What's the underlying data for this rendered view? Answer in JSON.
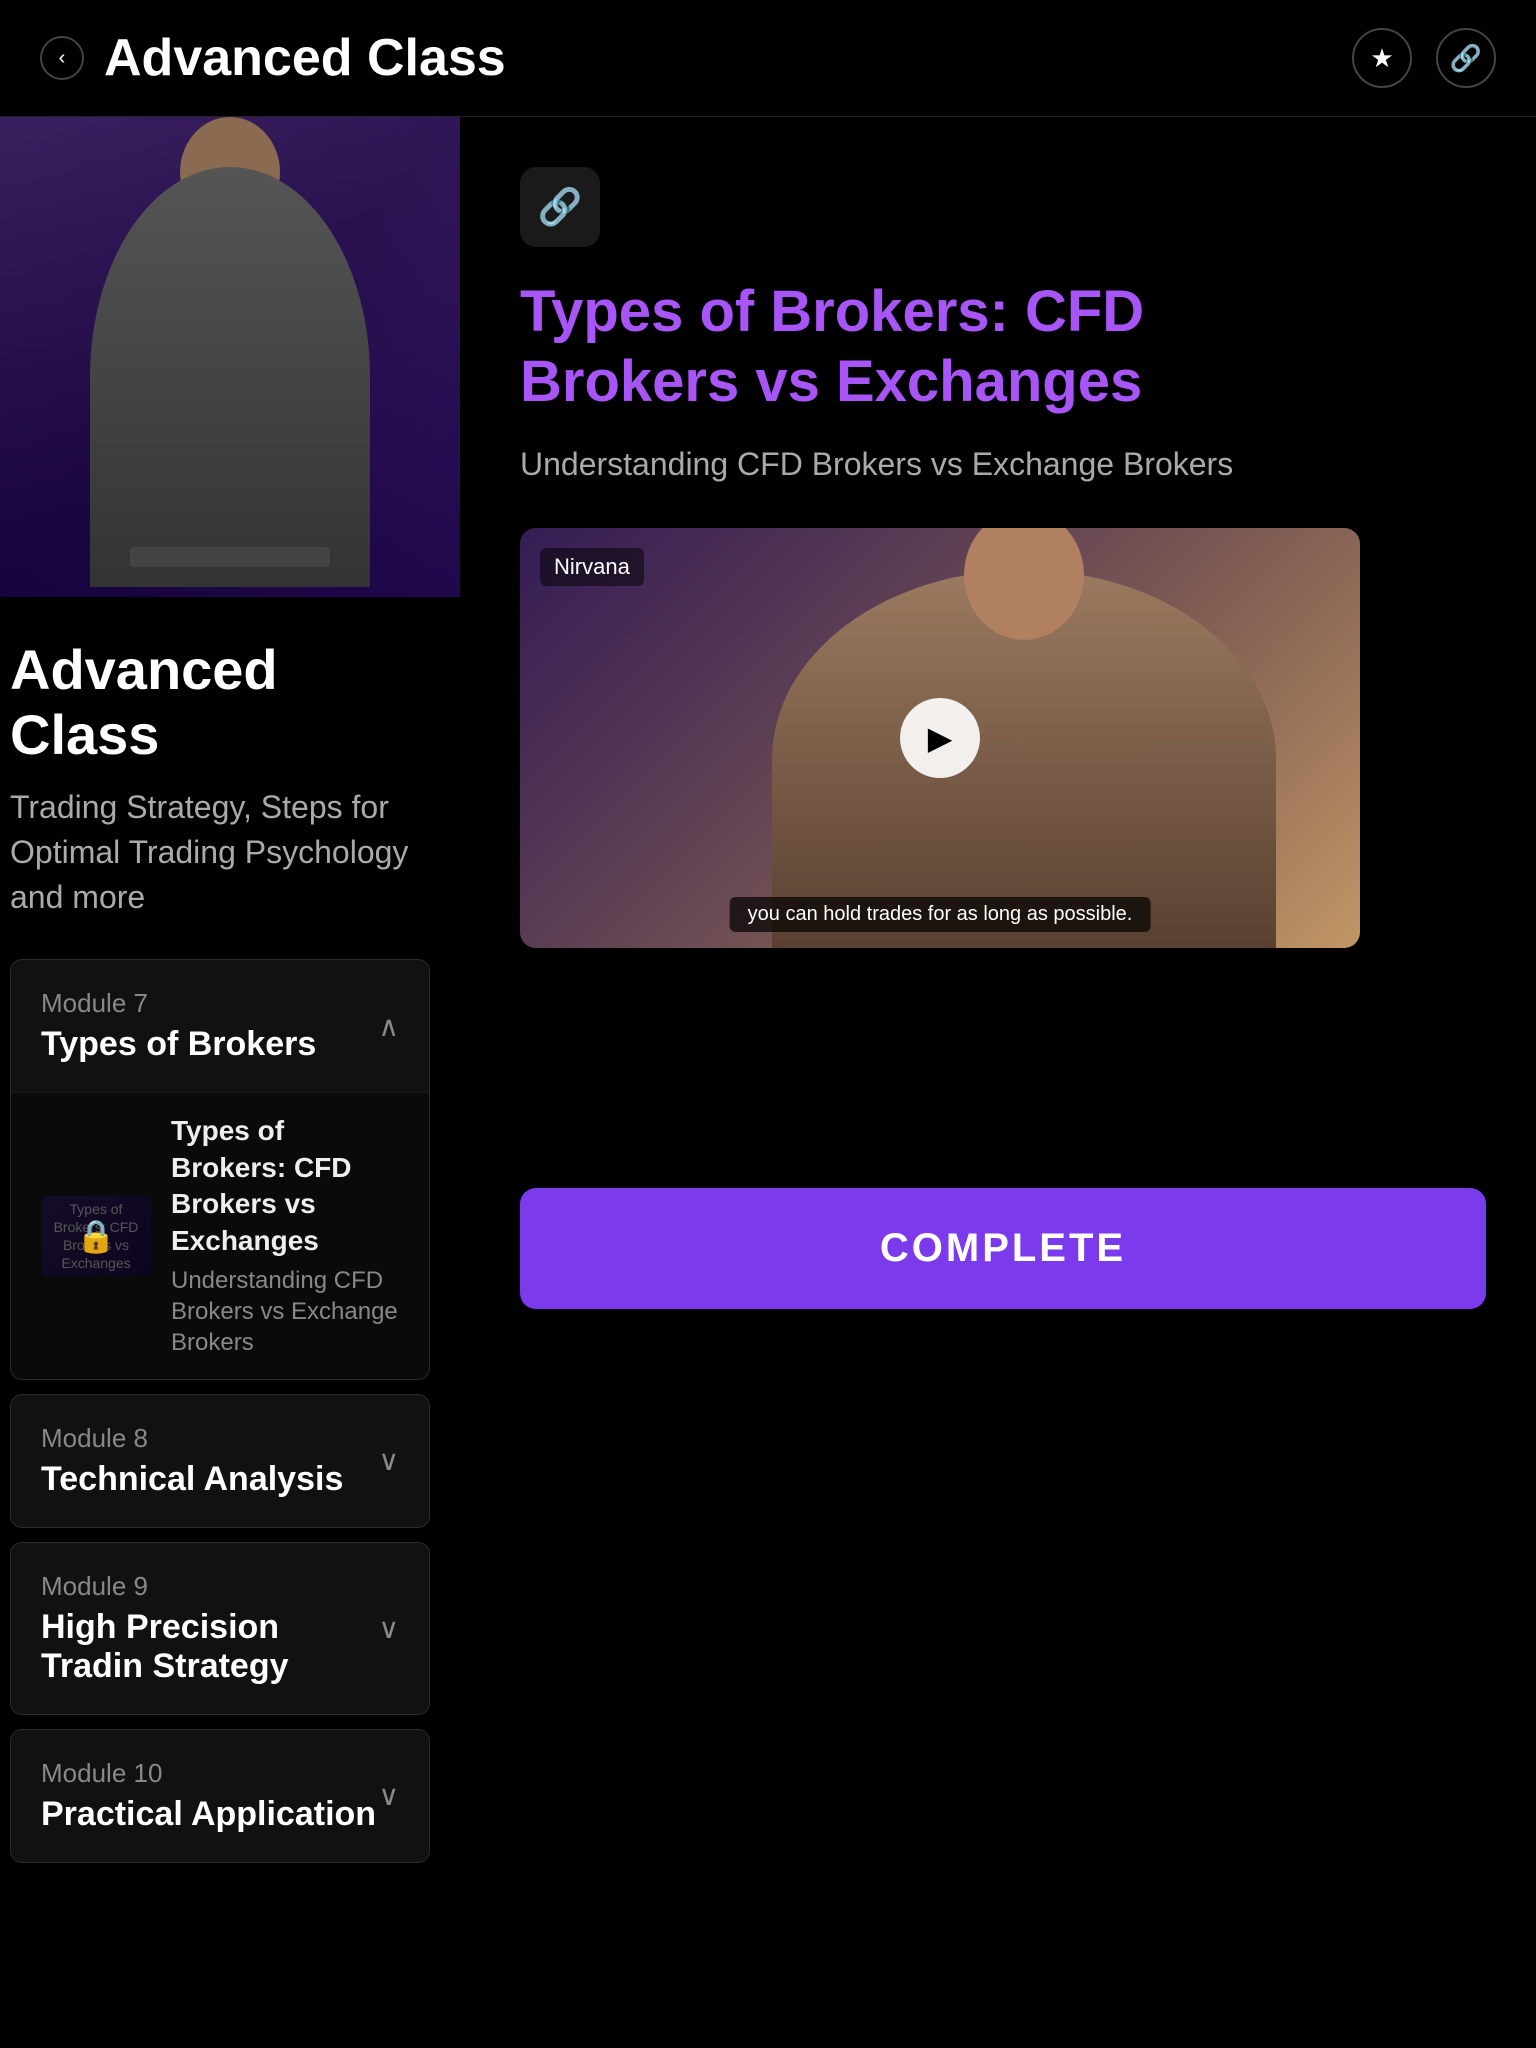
{
  "header": {
    "back_label": "‹",
    "title": "Advanced Class",
    "star_icon": "★",
    "link_icon": "🔗"
  },
  "hero": {
    "alt": "Instructor at laptop"
  },
  "course": {
    "title": "Advanced Class",
    "subtitle": "Trading Strategy, Steps for Optimal Trading Psychology and more"
  },
  "modules": [
    {
      "number": "Module 7",
      "name": "Types of Brokers",
      "expanded": true,
      "lessons": [
        {
          "title": "Types of Brokers: CFD Brokers vs Exchanges",
          "description": "Understanding CFD Brokers vs Exchange Brokers",
          "locked": true
        }
      ]
    },
    {
      "number": "Module 8",
      "name": "Technical Analysis",
      "expanded": false,
      "lessons": []
    },
    {
      "number": "Module 9",
      "name": "High Precision Tradin Strategy",
      "expanded": false,
      "lessons": []
    },
    {
      "number": "Module 10",
      "name": "Practical Application",
      "expanded": false,
      "lessons": []
    }
  ],
  "lesson_detail": {
    "link_icon": "🔗",
    "title_part1": "Types of Brokers: CFD",
    "title_part2": "Brokers vs Exchanges",
    "description": "Understanding CFD Brokers vs Exchange Brokers",
    "video": {
      "channel": "Nirvana",
      "caption": "you can hold trades for as long as possible.",
      "play_icon": "▶"
    }
  },
  "complete_button": {
    "label": "COMPLETE"
  }
}
